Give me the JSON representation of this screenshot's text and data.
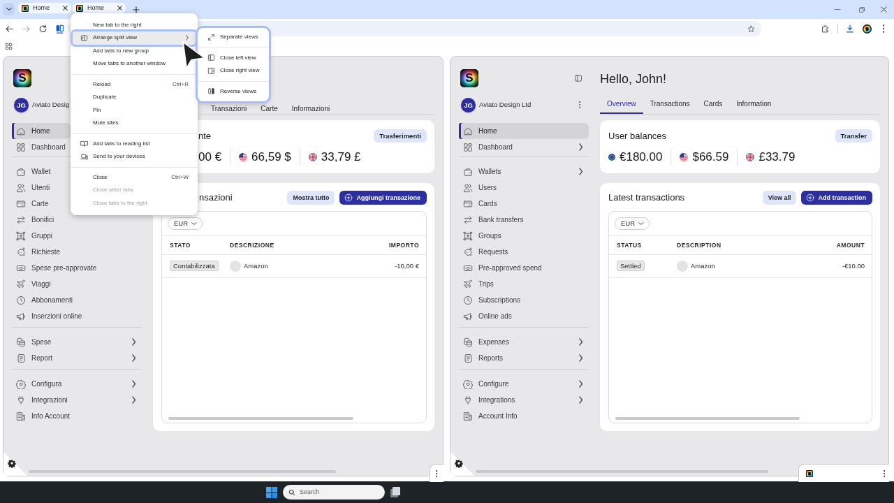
{
  "browser": {
    "tabs": [
      {
        "title": "Home",
        "selected": true
      },
      {
        "title": "Home",
        "selected": true
      }
    ],
    "nav_buttons": [
      {
        "kind": "back",
        "disabled": false
      },
      {
        "kind": "forward",
        "disabled": true
      },
      {
        "kind": "reload",
        "disabled": false
      }
    ]
  },
  "context_menu": {
    "groups": [
      {
        "items": [
          {
            "label": "New tab to the right",
            "highlighted": false,
            "disabled": false,
            "submenu": false
          },
          {
            "label": "Arrange split view",
            "highlighted": true,
            "disabled": false,
            "submenu": true
          },
          {
            "label": "Add tabs to new group",
            "highlighted": false,
            "disabled": false
          },
          {
            "label": "Move tabs to another window",
            "highlighted": false,
            "disabled": false
          }
        ]
      },
      {
        "items": [
          {
            "label": "Reload",
            "shortcut": "Ctrl+R",
            "highlighted": false,
            "disabled": false,
            "submenu": false
          },
          {
            "label": "Duplicate",
            "highlighted": false,
            "disabled": false,
            "submenu": false
          },
          {
            "label": "Pin",
            "highlighted": false,
            "disabled": false,
            "submenu": false
          },
          {
            "label": "Mute sites",
            "highlighted": false,
            "disabled": false,
            "submenu": false
          }
        ]
      },
      {
        "items": [
          {
            "label": "Add tabs to reading list",
            "highlighted": false,
            "disabled": false,
            "submenu": false
          },
          {
            "label": "Send to your devices",
            "highlighted": false,
            "disabled": false,
            "submenu": false
          }
        ]
      },
      {
        "items": [
          {
            "label": "Close",
            "shortcut": "Ctrl+W",
            "highlighted": false,
            "disabled": false,
            "submenu": false
          },
          {
            "label": "Close other tabs",
            "highlighted": false,
            "disabled": true,
            "submenu": false
          },
          {
            "label": "Close tabs to the right",
            "highlighted": false,
            "disabled": true,
            "submenu": false
          }
        ]
      }
    ]
  },
  "submenu": {
    "groups": [
      {
        "items": [
          {
            "label": "Separate views"
          }
        ]
      },
      {
        "items": [
          {
            "label": "Close left view"
          },
          {
            "label": "Close right view"
          }
        ]
      },
      {
        "items": [
          {
            "label": "Reverse views"
          }
        ]
      }
    ]
  },
  "panes": [
    {
      "logo_text": "S",
      "account": {
        "initials": "JG",
        "name": "Aviato Desig"
      },
      "nav_groups": [
        {
          "items": [
            {
              "label": "Home",
              "selected": true
            },
            {
              "label": "Dashboard",
              "selected": false
            }
          ]
        },
        {
          "items": [
            {
              "label": "Wallet",
              "selected": false
            },
            {
              "label": "Utenti",
              "selected": false
            },
            {
              "label": "Carte",
              "selected": false
            },
            {
              "label": "Bonifici",
              "selected": false,
              "chevron": false
            },
            {
              "label": "Gruppi",
              "selected": false,
              "chevron": false
            },
            {
              "label": "Richieste",
              "selected": false,
              "chevron": false
            },
            {
              "label": "Spese pre-approvate",
              "selected": false,
              "chevron": false
            },
            {
              "label": "Viaggi",
              "selected": false,
              "chevron": false
            },
            {
              "label": "Abbonamenti",
              "selected": false,
              "chevron": false
            },
            {
              "label": "Inserzioni online",
              "selected": false,
              "chevron": false
            }
          ]
        },
        {
          "items": [
            {
              "label": "Spese",
              "selected": false,
              "chevron": true
            },
            {
              "label": "Report",
              "selected": false,
              "chevron": true
            }
          ]
        },
        {
          "items": [
            {
              "label": "Configura",
              "selected": false,
              "chevron": true
            },
            {
              "label": "Integrazioni",
              "selected": false,
              "chevron": true
            },
            {
              "label": "Info Account",
              "selected": false,
              "chevron": false
            }
          ]
        }
      ],
      "tabs": [
        {
          "label": "Transazioni",
          "selected": false
        },
        {
          "label": "Carte",
          "selected": false
        },
        {
          "label": "Informazioni",
          "selected": false
        }
      ],
      "balances": {
        "title": "nte",
        "button": "Trasferimenti",
        "items": [
          {
            "kind": "text_only",
            "amount": "00 €"
          },
          {
            "kind": "usd",
            "amount": "66,59 $"
          },
          {
            "kind": "gbp",
            "amount": "33,79 £"
          }
        ]
      },
      "transactions": {
        "title": "nsazioni",
        "buttons": [
          {
            "kind": "secondary",
            "label": "Mostra tutto"
          },
          {
            "kind": "primary",
            "label": "Aggiungi transazione"
          }
        ],
        "currency": "EUR",
        "columns": [
          "STATO",
          "DESCRIZIONE",
          "IMPORTO"
        ],
        "rows": [
          {
            "status": "Contabilizzata",
            "description": "Amazon",
            "amount": "-10,00 €"
          }
        ]
      }
    },
    {
      "logo_text": "S",
      "sidebar_toggle": true,
      "account": {
        "initials": "JG",
        "name": "Aviato Design Ltd",
        "more_button": true
      },
      "nav_groups": [
        {
          "items": [
            {
              "label": "Home",
              "selected": true,
              "chevron": false
            },
            {
              "label": "Dashboard",
              "selected": false,
              "chevron": true
            }
          ]
        },
        {
          "items": [
            {
              "label": "Wallets",
              "selected": false,
              "chevron": true
            },
            {
              "label": "Users",
              "selected": false,
              "chevron": false
            },
            {
              "label": "Cards",
              "selected": false,
              "chevron": false
            },
            {
              "label": "Bank transfers",
              "selected": false,
              "chevron": false
            },
            {
              "label": "Groups",
              "selected": false,
              "chevron": false
            },
            {
              "label": "Requests",
              "selected": false,
              "chevron": false
            },
            {
              "label": "Pre-approved spend",
              "selected": false,
              "chevron": false
            },
            {
              "label": "Trips",
              "selected": false,
              "chevron": false
            },
            {
              "label": "Subscriptions",
              "selected": false,
              "chevron": false
            },
            {
              "label": "Online ads",
              "selected": false,
              "chevron": false
            }
          ]
        },
        {
          "items": [
            {
              "label": "Expenses",
              "selected": false,
              "chevron": true
            },
            {
              "label": "Reports",
              "selected": false,
              "chevron": true
            }
          ]
        },
        {
          "items": [
            {
              "label": "Configure",
              "selected": false,
              "chevron": true
            },
            {
              "label": "Integrations",
              "selected": false,
              "chevron": true
            },
            {
              "label": "Account Info",
              "selected": false,
              "chevron": false
            }
          ]
        }
      ],
      "title": "Hello, John!",
      "tabs": [
        {
          "label": "Overview",
          "selected": true
        },
        {
          "label": "Transactions",
          "selected": false
        },
        {
          "label": "Cards",
          "selected": false
        },
        {
          "label": "Information",
          "selected": false
        }
      ],
      "balances": {
        "title": "User balances",
        "button": "Transfer",
        "items": [
          {
            "kind": "eur",
            "amount": "€180.00"
          },
          {
            "kind": "usd",
            "amount": "$66.59"
          },
          {
            "kind": "gbp",
            "amount": "£33.79"
          }
        ]
      },
      "transactions": {
        "title": "Latest transactions",
        "buttons": [
          {
            "kind": "secondary",
            "label": "View all"
          },
          {
            "kind": "primary",
            "label": "Add transaction"
          }
        ],
        "currency": "EUR",
        "columns": [
          "STATUS",
          "DESCRIPTION",
          "AMOUNT"
        ],
        "rows": [
          {
            "status": "Settled",
            "description": "Amazon",
            "amount": "-€10.00"
          }
        ]
      },
      "footer_favicon": true
    }
  ],
  "taskbar": {
    "search": {
      "placeholder": "Search"
    }
  }
}
